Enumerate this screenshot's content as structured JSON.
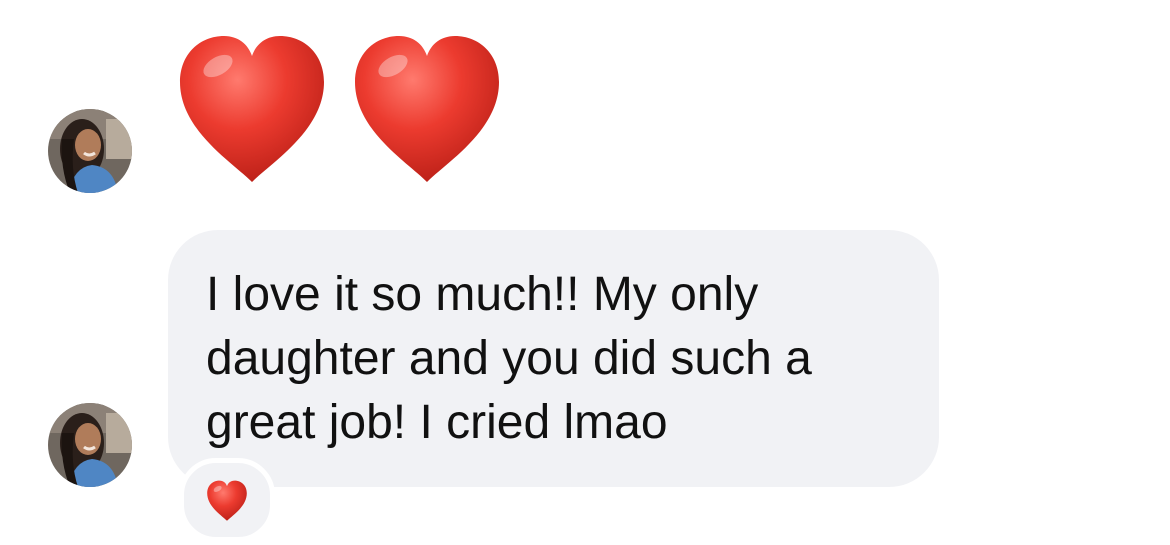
{
  "thread": {
    "emoji_message": {
      "icon": "red-heart-icon",
      "count": 2
    },
    "text_message": {
      "text": "I love it so much!! My only\ndaughter and you did such a\ngreat job! I cried lmao",
      "reaction": {
        "icon": "red-heart-icon"
      }
    }
  },
  "colors": {
    "bubble": "#f1f2f5",
    "text": "#111111",
    "heart": "#e8382e"
  }
}
